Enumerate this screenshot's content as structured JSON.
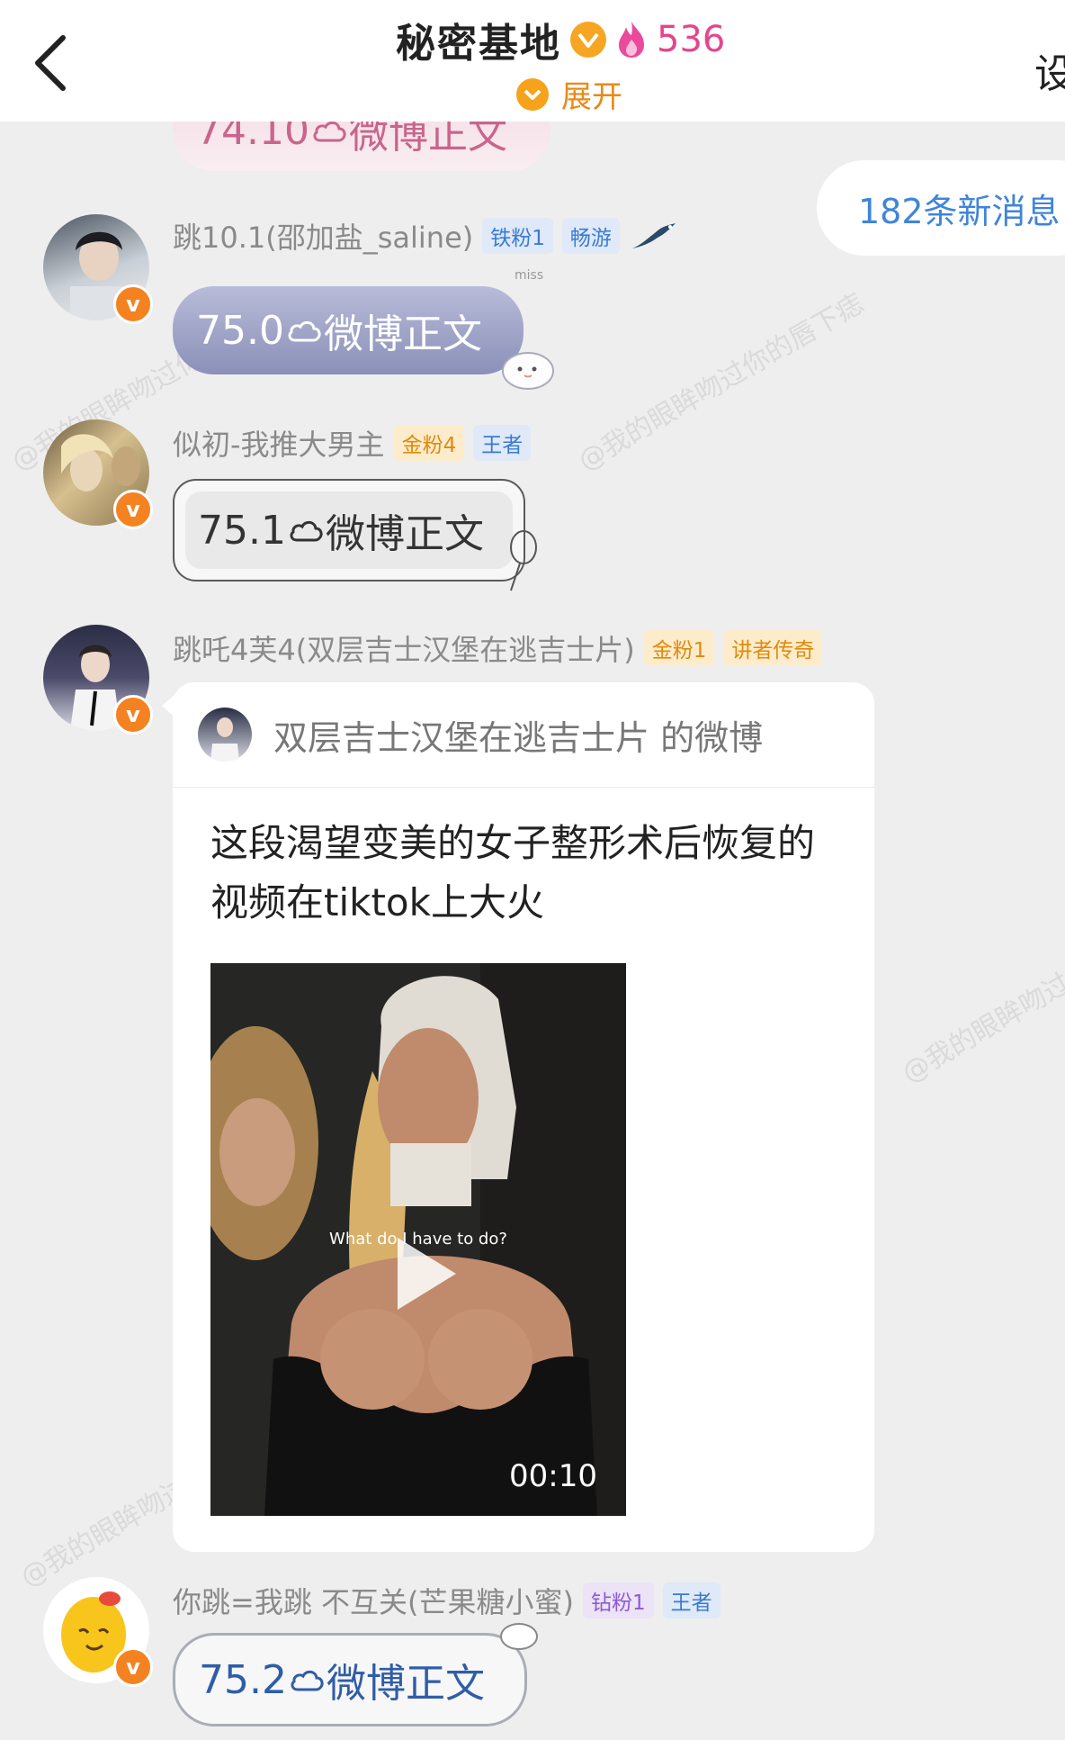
{
  "header": {
    "title": "秘密基地",
    "fans_count": "536",
    "expand_label": "展开",
    "settings_label": "设"
  },
  "new_messages": "182条新消息",
  "top_bubble": {
    "text_num": "74.10",
    "text_label": "微博正文"
  },
  "messages": [
    {
      "sender": "跳10.1(邵加盐_saline)",
      "badges": [
        "铁粉1",
        "畅游"
      ],
      "bubble_num": "75.0",
      "bubble_label": "微博正文",
      "bubble_deco": "miss"
    },
    {
      "sender": "似初-我推大男主",
      "badges": [
        "金粉4",
        "王者"
      ],
      "bubble_num": "75.1",
      "bubble_label": "微博正文"
    },
    {
      "sender": "跳吒4芙4(双层吉士汉堡在逃吉士片)",
      "badges": [
        "金粉1",
        "讲者传奇"
      ]
    },
    {
      "sender": "你跳=我跳 不互关(芒果糖小蜜)",
      "badges": [
        "钻粉1",
        "王者"
      ],
      "bubble_num": "75.2",
      "bubble_label": "微博正文"
    }
  ],
  "shared_card": {
    "source": "双层吉士汉堡在逃吉士片 的微博",
    "text": "这段渴望变美的女子整形术后恢复的视频在tiktok上大火",
    "video_caption": "What do I have to do?",
    "duration": "00:10"
  },
  "watermark": "@我的眼眸吻过你的唇下痣",
  "colors": {
    "accent_blue": "#3f85d9",
    "fans_pink": "#e6458b",
    "expand_orange": "#e88a17"
  }
}
